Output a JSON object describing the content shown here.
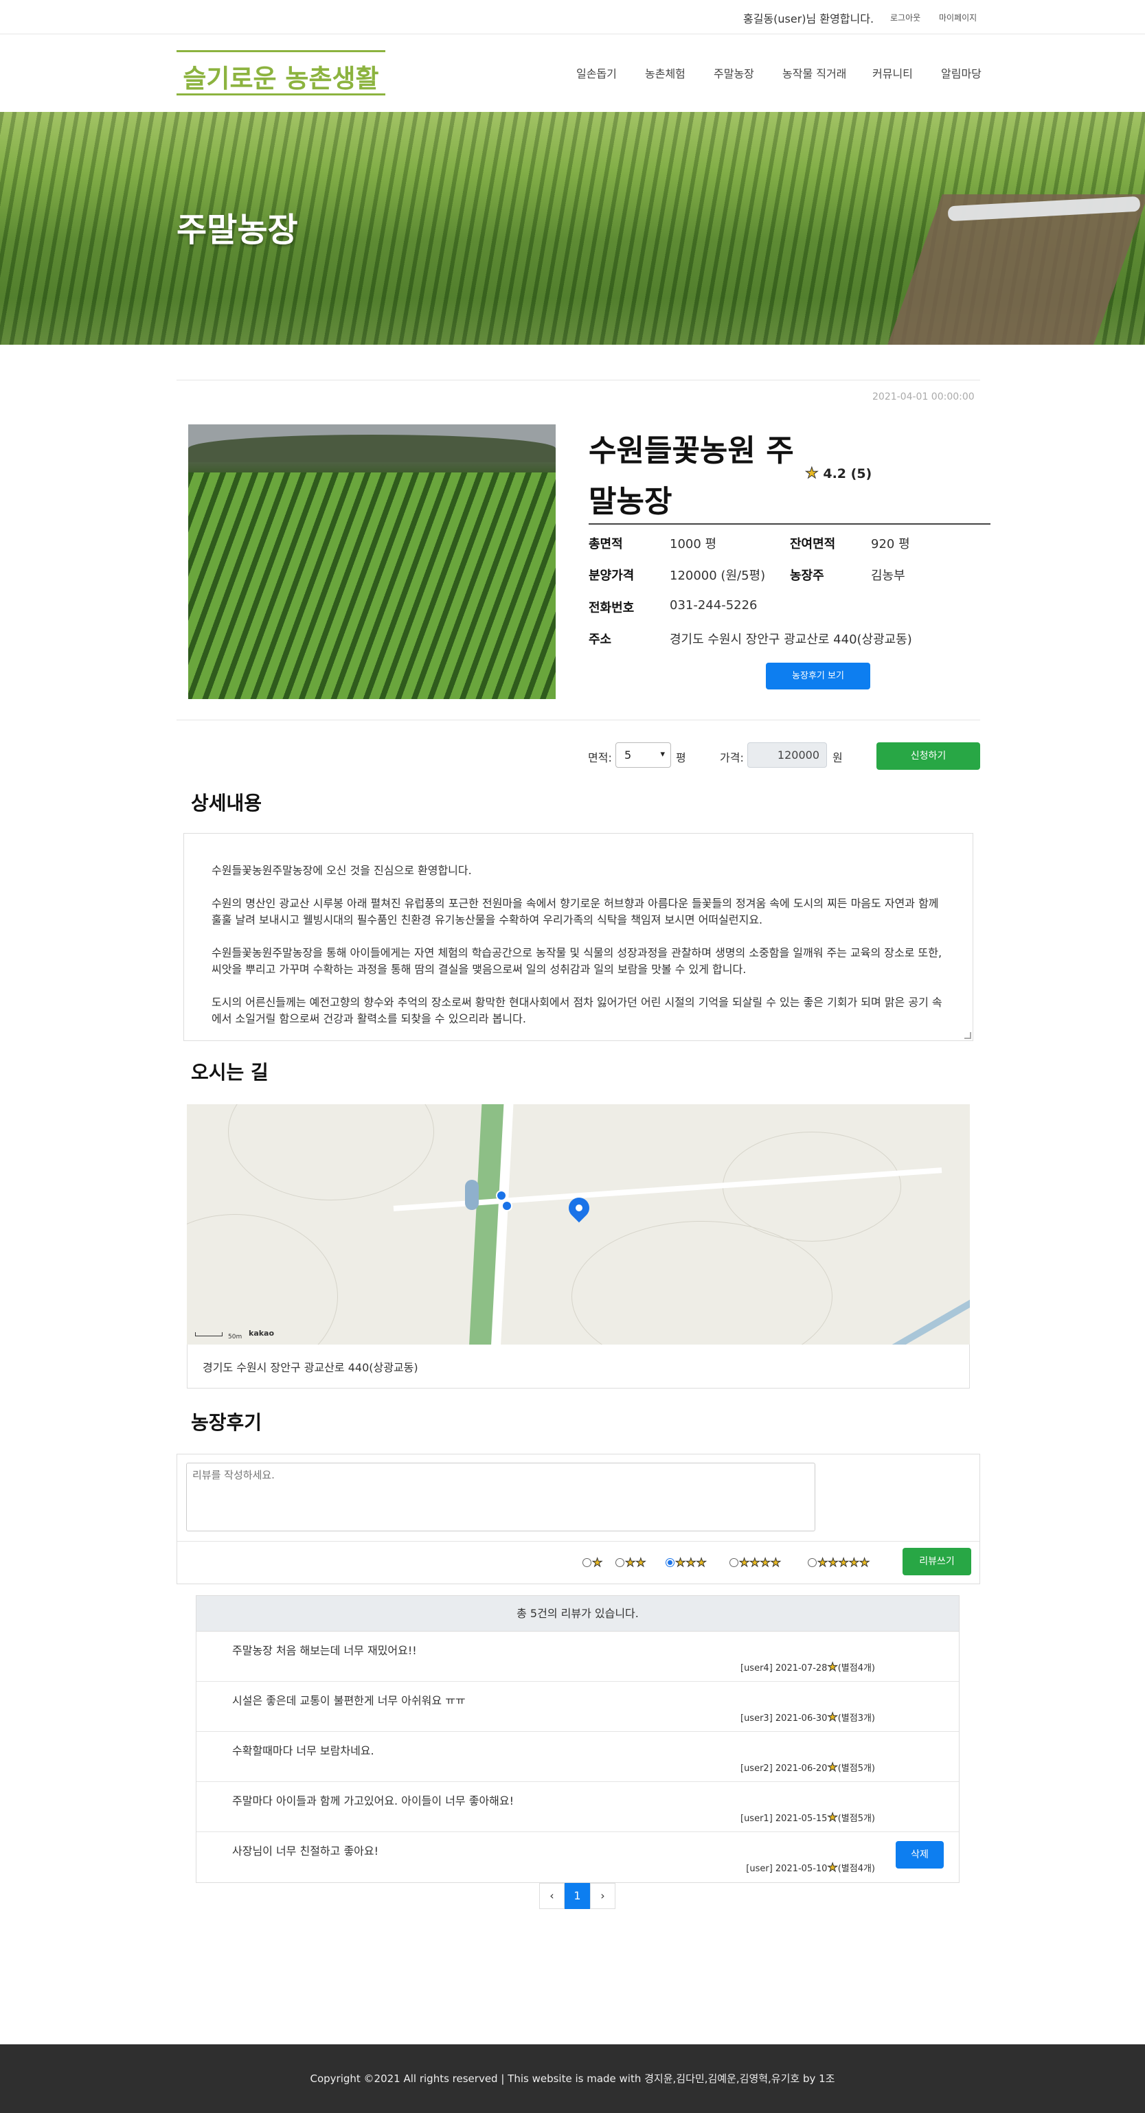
{
  "topbar": {
    "welcome": "홍길동(user)님 환영합니다.",
    "logout": "로그아웃",
    "mypage": "마이페이지"
  },
  "header": {
    "logo": "슬기로운 농촌생활",
    "nav": [
      "일손돕기",
      "농촌체험",
      "주말농장",
      "농작물 직거래",
      "커뮤니티",
      "알림마당"
    ]
  },
  "hero": {
    "title": "주말농장"
  },
  "farm": {
    "date": "2021-04-01 00:00:00",
    "name": "수원들꽃농원 주말농장",
    "rating": "4.2 (5)",
    "fields": {
      "total_area_label": "총면적",
      "total_area": "1000 평",
      "remain_area_label": "잔여면적",
      "remain_area": "920 평",
      "price_label": "분양가격",
      "price": "120000 (원/5평)",
      "owner_label": "농장주",
      "owner": "김농부",
      "phone_label": "전화번호",
      "phone": "031-244-5226",
      "address_label": "주소",
      "address": "경기도 수원시 장안구 광교산로 440(상광교동)"
    },
    "review_button": "농장후기 보기"
  },
  "apply": {
    "area_label": "면적:",
    "area_value": "5",
    "area_unit": "평",
    "price_label": "가격:",
    "price_value": "120000",
    "price_unit": "원",
    "apply_button": "신청하기"
  },
  "detail": {
    "title": "상세내용",
    "paragraphs": [
      "수원들꽃농원주말농장에 오신 것을 진심으로 환영합니다.",
      "수원의 명산인 광교산 시루봉 아래 펼쳐진 유럽풍의 포근한 전원마을 속에서 향기로운 허브향과 아름다운 들꽃들의 정겨움 속에 도시의 찌든 마음도 자연과 함께 훌훌 날려 보내시고 웰빙시대의 필수품인 친환경 유기농산물을 수확하여 우리가족의 식탁을 책임져 보시면 어떠실런지요.",
      "수원들꽃농원주말농장을 통해 아이들에게는 자연 체험의 학습공간으로 농작물 및 식물의 성장과정을 관찰하며 생명의 소중함을 일깨워 주는 교육의 장소로 또한, 씨앗을 뿌리고 가꾸며 수확하는 과정을 통해 땀의 결실을 맺음으로써 일의 성취감과 일의 보람을 맛볼 수 있게 합니다.",
      "도시의 어른신들께는 예전고향의 향수와 추억의 장소로써 황막한 현대사회에서 점차 잃어가던 어린 시절의 기억을 되살릴 수 있는 좋은 기회가 되며 맑은 공기 속에서 소일거릴 함으로써 건강과 활력소를 되찾을 수 있으리라 봅니다."
    ]
  },
  "location": {
    "title": "오시는 길",
    "scale": "50m",
    "map_brand": "kakao",
    "address": "경기도 수원시 장안구 광교산로 440(상광교동)"
  },
  "reviews": {
    "title": "농장후기",
    "placeholder": "리뷰를 작성하세요.",
    "star_options": [
      "★",
      "★★",
      "★★★",
      "★★★★",
      "★★★★★"
    ],
    "selected_option": 3,
    "write_button": "리뷰쓰기",
    "summary": "총 5건의 리뷰가 있습니다.",
    "items": [
      {
        "content": "주말농장 처음 해보는데 너무 재밌어요!!",
        "meta": "[user4] 2021-07-28",
        "stars": "(별점4개)"
      },
      {
        "content": "시설은 좋은데 교통이 불편한게 너무 아쉬워요 ㅠㅠ",
        "meta": "[user3] 2021-06-30",
        "stars": "(별점3개)"
      },
      {
        "content": "수확할때마다 너무 보람차네요.",
        "meta": "[user2] 2021-06-20",
        "stars": "(별점5개)"
      },
      {
        "content": "주말마다 아이들과 함께 가고있어요. 아이들이 너무 좋아해요!",
        "meta": "[user1] 2021-05-15",
        "stars": "(별점5개)"
      },
      {
        "content": "사장님이 너무 친절하고 좋아요!",
        "meta": "[user] 2021-05-10",
        "stars": "(별점4개)"
      }
    ],
    "delete_button": "삭제"
  },
  "pagination": {
    "prev": "‹",
    "current": "1",
    "next": "›"
  },
  "footer": {
    "text": "Copyright ©2021 All rights reserved | This website is made with 경지윤,김다민,김예운,김영혁,유기호 by 1조"
  },
  "colors": {
    "brand_green": "#8cb33f",
    "primary_blue": "#0d7ef0",
    "success_green": "#28a745",
    "footer_bg": "#2f2f2f"
  }
}
